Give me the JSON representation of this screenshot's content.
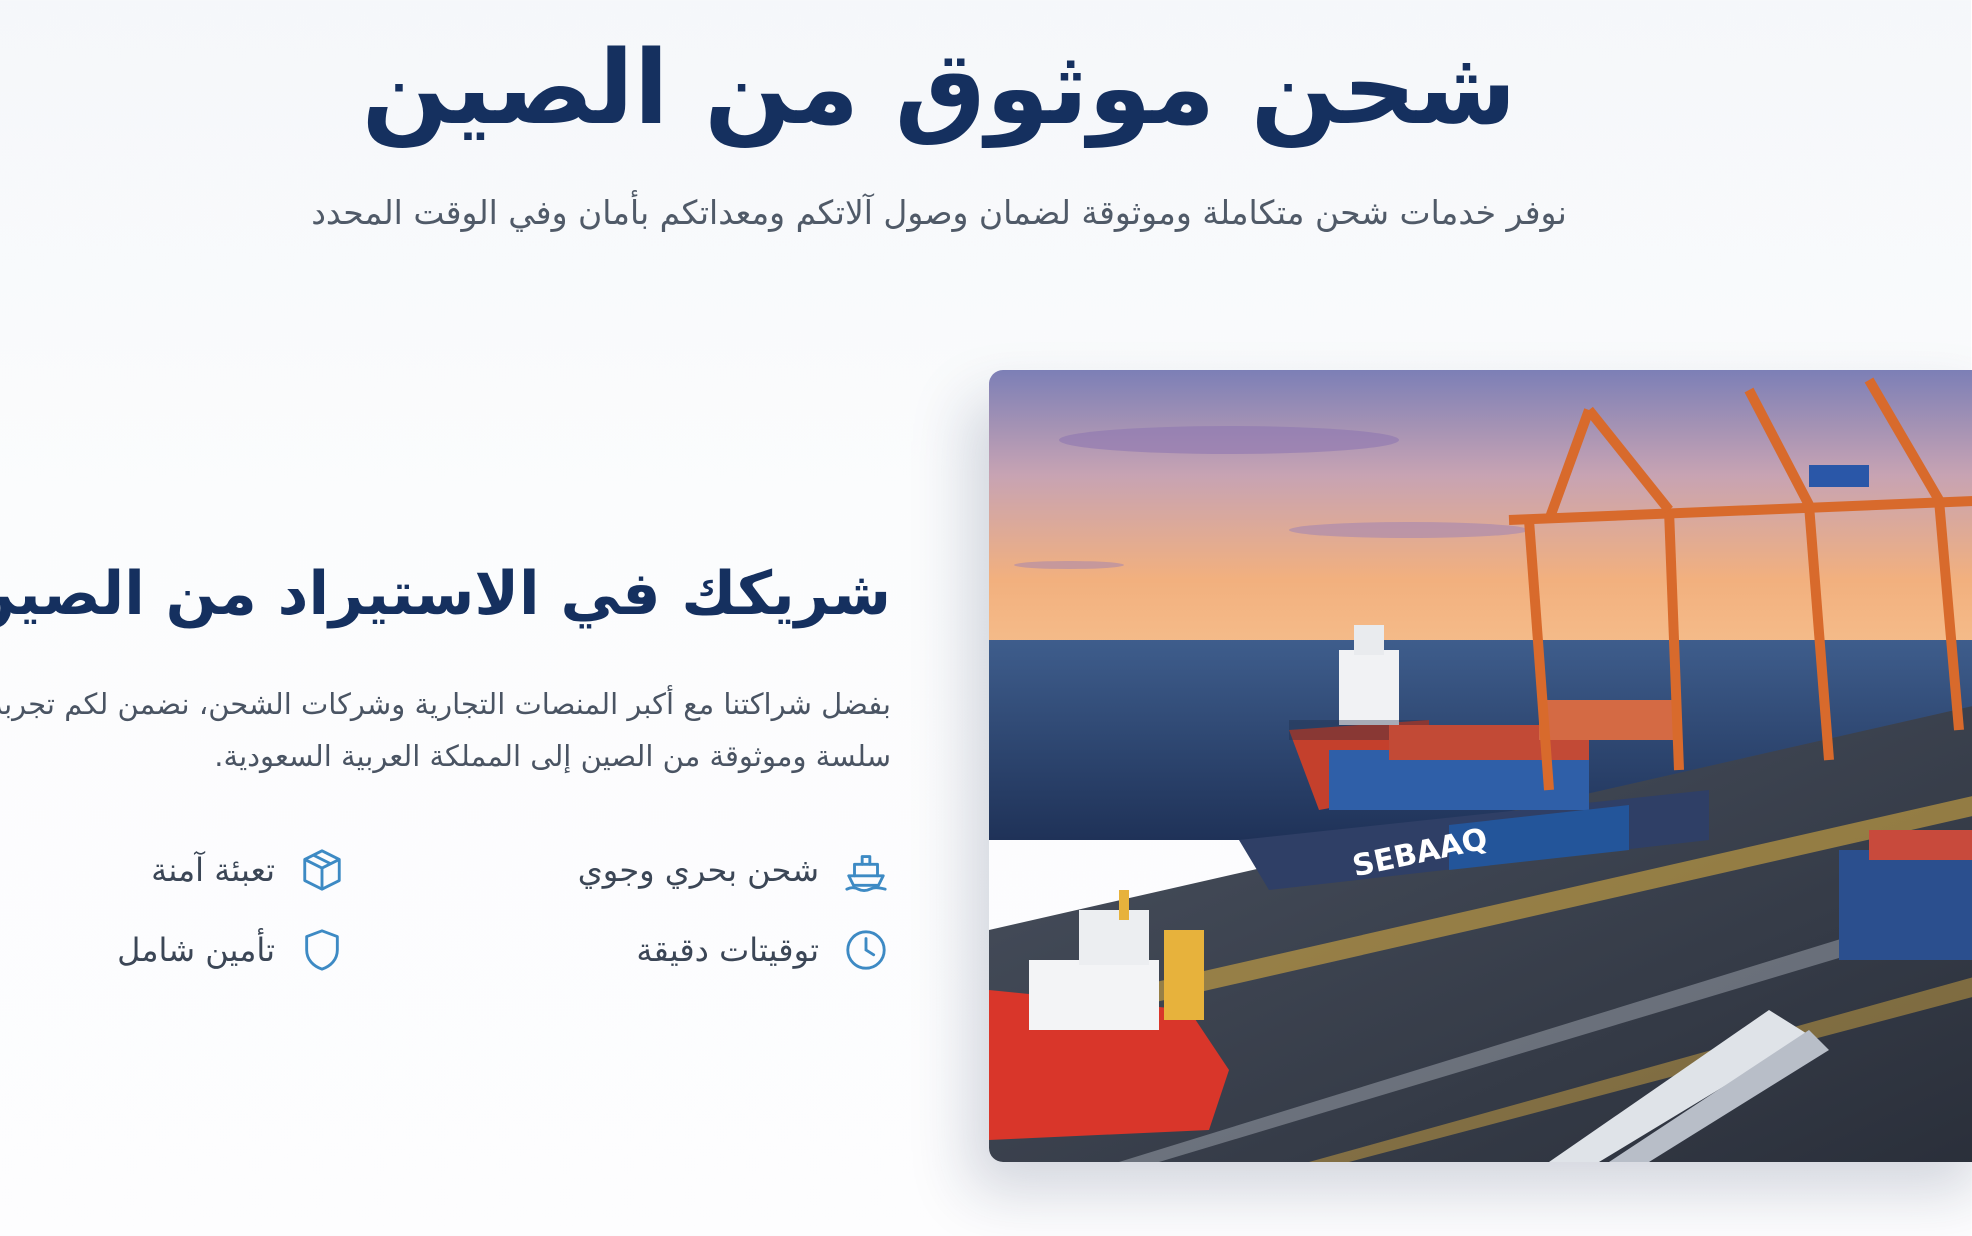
{
  "hero": {
    "title": "شحن موثوق من الصين",
    "subtitle": "نوفر خدمات شحن متكاملة وموثوقة لضمان وصول آلاتكم ومعداتكم بأمان وفي الوقت المحدد"
  },
  "section": {
    "title": "شريكك في الاستيراد من الصين",
    "description_line1": "بفضل شراكتنا مع أكبر المنصات التجارية وشركات الشحن، نضمن لكم تجربة شحن",
    "description_line2": "سلسة وموثوقة من الصين إلى المملكة العربية السعودية."
  },
  "features": [
    {
      "label": "شحن بحري وجوي",
      "icon": "ship-icon"
    },
    {
      "label": "تعبئة آمنة",
      "icon": "package-box-icon"
    },
    {
      "label": "توقيتات دقيقة",
      "icon": "clock-icon"
    },
    {
      "label": "تأمين شامل",
      "icon": "shield-icon"
    }
  ],
  "photo": {
    "ship_brand": "SEBAAQ"
  },
  "colors": {
    "heading": "#15305f",
    "body_text": "#4a5463",
    "icon_accent": "#3d8ac4",
    "background": "#f7f9fb"
  }
}
